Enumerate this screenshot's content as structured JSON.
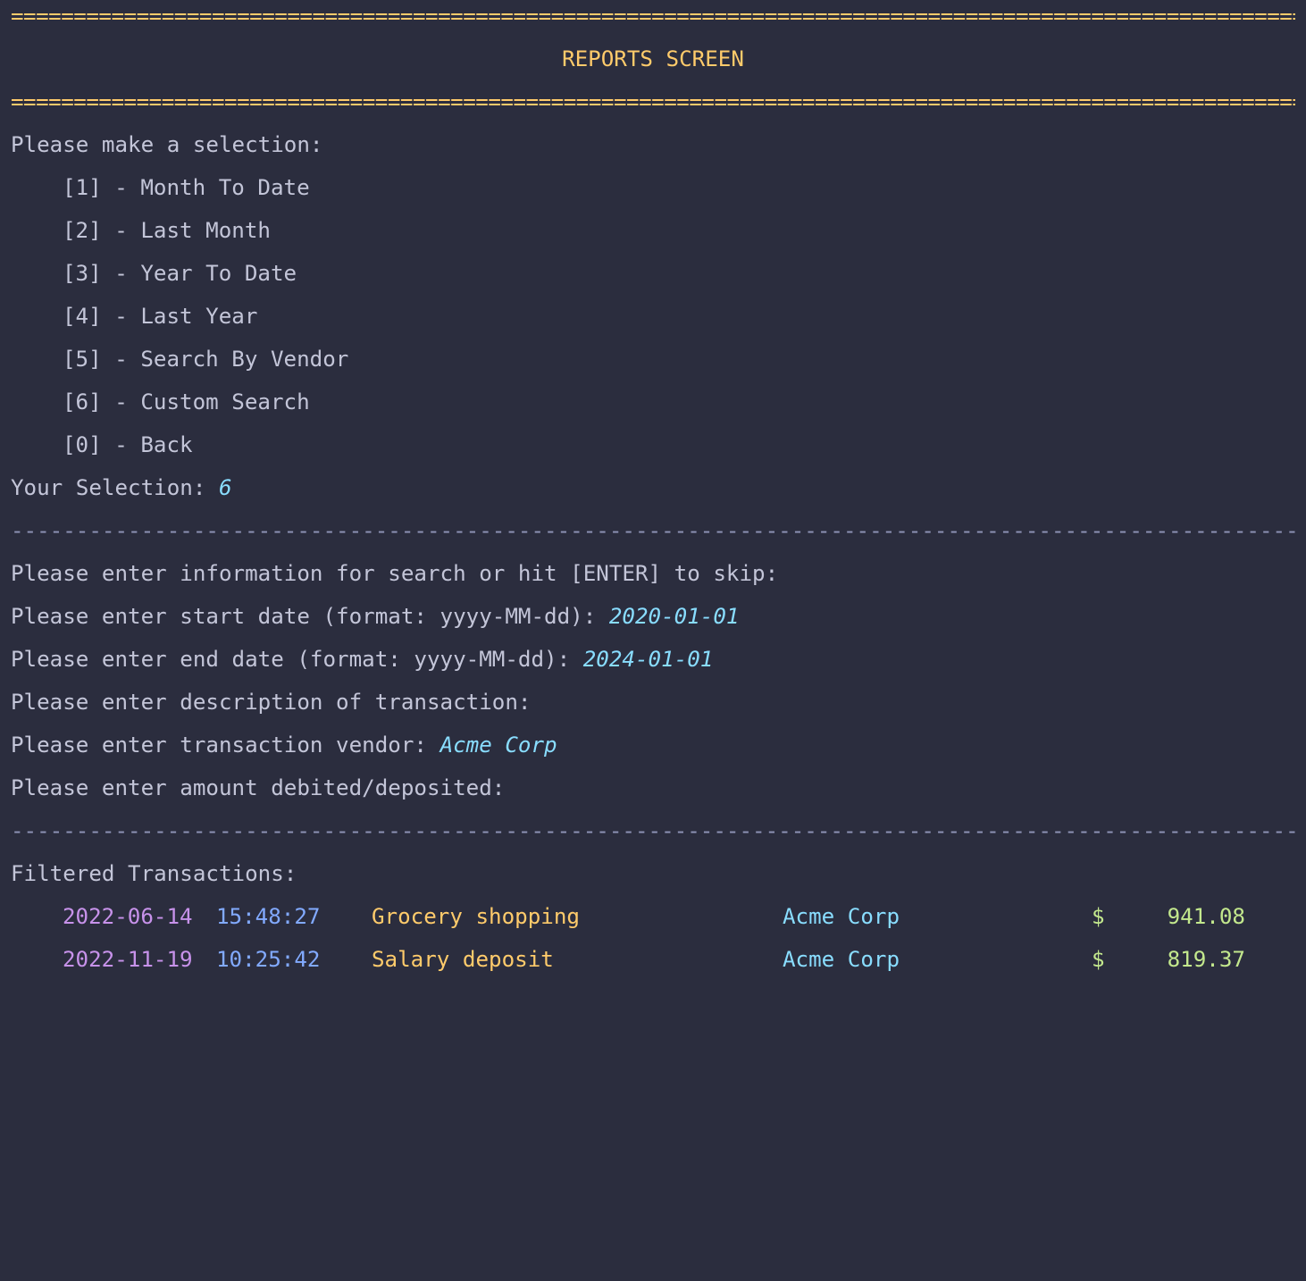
{
  "header": {
    "rule_top": "=======================================================================================================================================",
    "title": "REPORTS SCREEN",
    "rule_bottom": "======================================================================================================================================="
  },
  "menu": {
    "prompt": "Please make a selection:",
    "items": [
      {
        "label": "[1] - Month To Date"
      },
      {
        "label": "[2] - Last Month"
      },
      {
        "label": "[3] - Year To Date"
      },
      {
        "label": "[4] - Last Year"
      },
      {
        "label": "[5] - Search By Vendor"
      },
      {
        "label": "[6] - Custom Search"
      },
      {
        "label": "[0] - Back"
      }
    ],
    "selection_prompt": "Your Selection: ",
    "selection_value": "6"
  },
  "divider_1": "-----------------------------------------------------------------------------------------------------------------------------------------",
  "search": {
    "intro": "Please enter information for search or hit [ENTER] to skip:",
    "start_date_prompt": "Please enter start date (format: yyyy-MM-dd): ",
    "start_date_value": "2020-01-01",
    "end_date_prompt": "Please enter end date (format: yyyy-MM-dd): ",
    "end_date_value": "2024-01-01",
    "description_prompt": "Please enter description of transaction:",
    "vendor_prompt": "Please enter transaction vendor: ",
    "vendor_value": "Acme Corp",
    "amount_prompt": "Please enter amount debited/deposited:"
  },
  "divider_2": "-----------------------------------------------------------------------------------------------------------------------------------------",
  "results": {
    "heading": "Filtered Transactions:",
    "transactions": [
      {
        "date": "2022-06-14",
        "time": "15:48:27",
        "description": "Grocery shopping",
        "vendor": "Acme Corp",
        "currency": "$",
        "amount": "941.08"
      },
      {
        "date": "2022-11-19",
        "time": "10:25:42",
        "description": "Salary deposit",
        "vendor": "Acme Corp",
        "currency": "$",
        "amount": "819.37"
      }
    ]
  },
  "colors": {
    "background": "#2b2d3e",
    "text": "#c3c5d8",
    "accent_yellow": "#ffcb6b",
    "input_cyan": "#89ddff",
    "date_purple": "#c792ea",
    "time_blue": "#82aaff",
    "amount_green": "#c3e88d"
  }
}
